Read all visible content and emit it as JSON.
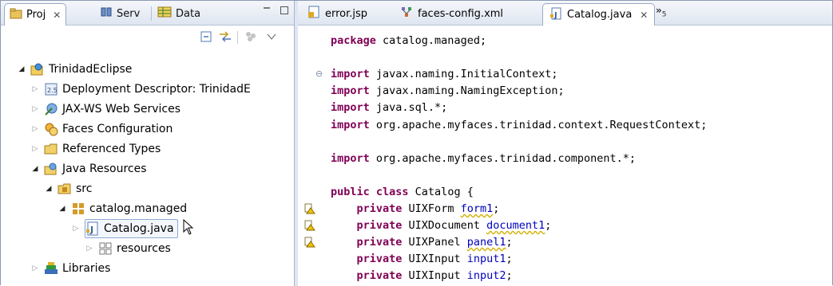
{
  "left_panel": {
    "tabs": [
      {
        "label": "Proj",
        "active": true,
        "icon": "project-explorer-icon",
        "close": "✕"
      },
      {
        "label": "Serv",
        "active": false,
        "icon": "servers-icon"
      },
      {
        "label": "Data",
        "active": false,
        "icon": "data-source-icon"
      }
    ],
    "toolbar": [
      "collapse-all-icon",
      "link-with-editor-icon",
      "filter-icon",
      "view-menu-icon"
    ],
    "tree": [
      {
        "label": "TrinidadEclipse",
        "icon": "web-project-icon",
        "depth": 0,
        "state": "expanded"
      },
      {
        "label": "Deployment Descriptor: TrinidadE",
        "icon": "deployment-descriptor-icon",
        "depth": 1,
        "state": "collapsed"
      },
      {
        "label": "JAX-WS Web Services",
        "icon": "web-services-icon",
        "depth": 1,
        "state": "collapsed"
      },
      {
        "label": "Faces Configuration",
        "icon": "faces-config-icon",
        "depth": 1,
        "state": "collapsed"
      },
      {
        "label": "Referenced Types",
        "icon": "folder-icon",
        "depth": 1,
        "state": "collapsed"
      },
      {
        "label": "Java Resources",
        "icon": "java-resources-icon",
        "depth": 1,
        "state": "expanded"
      },
      {
        "label": "src",
        "icon": "source-folder-icon",
        "depth": 2,
        "state": "expanded"
      },
      {
        "label": "catalog.managed",
        "icon": "package-icon",
        "depth": 3,
        "state": "expanded"
      },
      {
        "label": "Catalog.java",
        "icon": "java-file-icon",
        "depth": 4,
        "state": "collapsed",
        "selected": true
      },
      {
        "label": "resources",
        "icon": "package-icon",
        "depth": 3,
        "state": "collapsed"
      },
      {
        "label": "Libraries",
        "icon": "libraries-icon",
        "depth": 1,
        "state": "collapsed"
      }
    ]
  },
  "editor": {
    "tabs": [
      {
        "label": "error.jsp",
        "icon": "jsp-file-icon",
        "active": false
      },
      {
        "label": "faces-config.xml",
        "icon": "xml-file-icon",
        "active": false
      },
      {
        "label": "Catalog.java",
        "icon": "java-file-icon",
        "active": true,
        "close": "✕"
      }
    ],
    "overflow": {
      "symbol": "»",
      "count": "5"
    },
    "code": [
      {
        "kw": "package",
        "text": " catalog.managed;"
      },
      {
        "kw": "",
        "text": ""
      },
      {
        "kw": "import",
        "text": " javax.naming.InitialContext;",
        "fold": true
      },
      {
        "kw": "import",
        "text": " javax.naming.NamingException;"
      },
      {
        "kw": "import",
        "text": " java.sql.*;"
      },
      {
        "kw": "import",
        "text": " org.apache.myfaces.trinidad.context.RequestContext;"
      },
      {
        "kw": "",
        "text": ""
      },
      {
        "kw": "import",
        "text": " org.apache.myfaces.trinidad.component.*;"
      },
      {
        "kw": "",
        "text": ""
      },
      {
        "kw": "public class",
        "text": " Catalog {"
      },
      {
        "kw": "private",
        "text": " UIXForm ",
        "field": "form1",
        "indent": "    ",
        "warning": true
      },
      {
        "kw": "private",
        "text": " UIXDocument ",
        "field": "document1",
        "indent": "    ",
        "warning": true
      },
      {
        "kw": "private",
        "text": " UIXPanel ",
        "field": "panel1",
        "indent": "    ",
        "warning": true
      },
      {
        "kw": "private",
        "text": " UIXInput ",
        "field": "input1",
        "indent": "    "
      },
      {
        "kw": "private",
        "text": " UIXInput ",
        "field": "input2",
        "indent": "    "
      }
    ]
  },
  "colors": {
    "keyword": "#7f0055",
    "field": "#0000c0",
    "tab_gradient_top": "#f4f6fa",
    "tab_gradient_bottom": "#dfe6f1",
    "warning": "#d4b000"
  }
}
